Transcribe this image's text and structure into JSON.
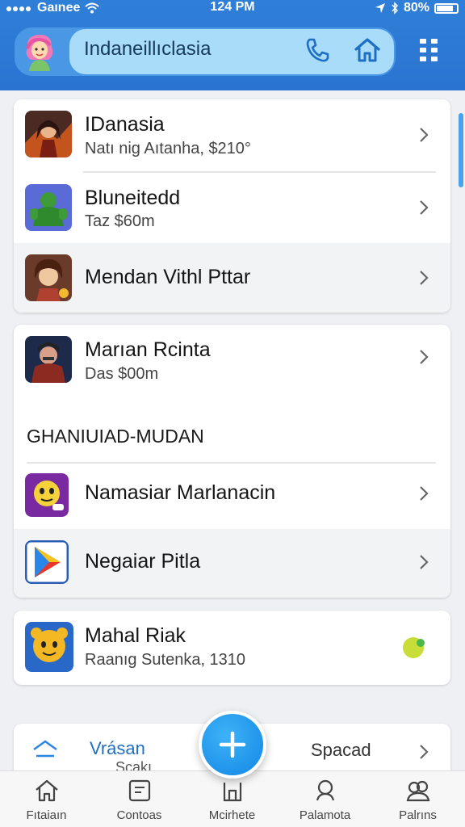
{
  "status_bar": {
    "carrier": "Gaınee",
    "time": "124 PM",
    "battery": "80%"
  },
  "header": {
    "search_text": "Indaneillıclasia",
    "phone_icon": "phone-icon",
    "home_icon": "home-icon",
    "menu_icon": "grid-menu-icon"
  },
  "card1": {
    "items": [
      {
        "title": "IDanasia",
        "subtitle": "Natı nig Aıtanha, $210°"
      },
      {
        "title": "Bluneitedd",
        "subtitle": "Taz $60m"
      },
      {
        "title": "Mendan Vithl Pttar"
      }
    ]
  },
  "card2": {
    "items": [
      {
        "title": "Marıan Rcinta",
        "subtitle": "Das $00m"
      }
    ],
    "section_label": "GHANIUIAD-MUDAN",
    "section_items": [
      {
        "title": "Namasiar Marlanacin"
      },
      {
        "title": "Negaiar Pitla"
      }
    ]
  },
  "card3": {
    "title": "Mahal Riak",
    "subtitle": "Raanıg Sutenka, 1310"
  },
  "bottom_card": {
    "left_label": "Vrásan",
    "left_sublabel": "Scakı",
    "right_label": "Spacad"
  },
  "tabs": [
    {
      "label": "Fıtaiaın",
      "icon": "home-icon"
    },
    {
      "label": "Contoas",
      "icon": "contacts-icon"
    },
    {
      "label": "Mcirhete",
      "icon": "market-icon"
    },
    {
      "label": "Palamota",
      "icon": "profile-icon"
    },
    {
      "label": "Palrıns",
      "icon": "people-icon"
    }
  ],
  "colors": {
    "header_blue": "#2f7fd8",
    "accent_blue": "#1f94ea",
    "search_bg": "#a9dcf8"
  }
}
